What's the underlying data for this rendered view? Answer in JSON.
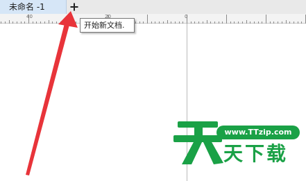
{
  "tabs": {
    "active_label": "未命名 -1",
    "new_tab_tooltip": "开始新文档."
  },
  "ruler": {
    "labels": [
      "40",
      "20",
      "0"
    ]
  },
  "watermark": {
    "url": "www.TTzip.com",
    "name": "天下载",
    "logo_char": "天",
    "color": "#1aa146"
  },
  "colors": {
    "tab_active": "#d6e6f7",
    "annotation_arrow": "#e8343a"
  }
}
